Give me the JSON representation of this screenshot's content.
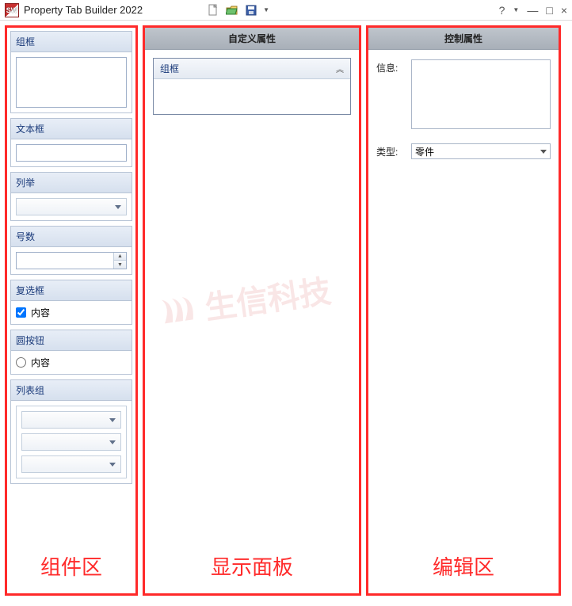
{
  "titlebar": {
    "app_name": "Property Tab Builder 2022",
    "icon_text": "SW"
  },
  "toolbar": {
    "new_icon": "new",
    "open_icon": "open",
    "save_icon": "save"
  },
  "window_controls": {
    "help": "?",
    "min": "—",
    "restore": "□",
    "close": "×"
  },
  "left_panel": {
    "sections": {
      "groupbox": {
        "header": "组框"
      },
      "textbox": {
        "header": "文本框"
      },
      "list": {
        "header": "列举"
      },
      "number": {
        "header": "号数"
      },
      "checkbox": {
        "header": "复选框",
        "item_label": "内容"
      },
      "radio": {
        "header": "圆按钮",
        "item_label": "内容"
      },
      "listgroup": {
        "header": "列表组"
      }
    },
    "zone_label": "组件区"
  },
  "mid_panel": {
    "header": "自定义属性",
    "group_label": "组框",
    "zone_label": "显示面板"
  },
  "right_panel": {
    "header": "控制属性",
    "info_label": "信息:",
    "type_label": "类型:",
    "type_value": "零件",
    "zone_label": "编辑区"
  },
  "watermark": {
    "text": "生信科技"
  }
}
